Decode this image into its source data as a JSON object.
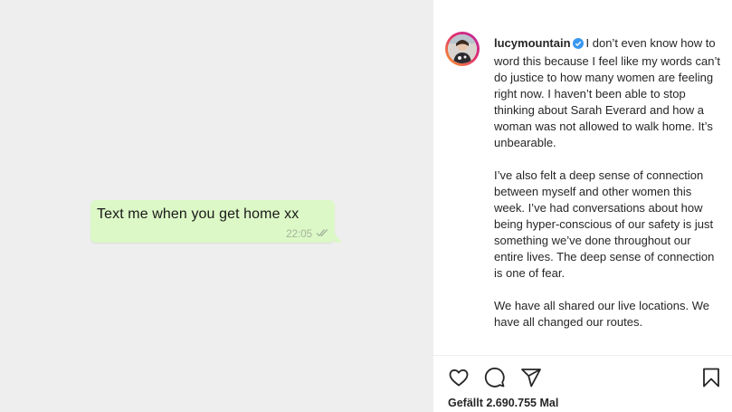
{
  "media": {
    "message_text": "Text me when you get home xx",
    "message_time": "22:05",
    "bubble_color": "#dcf8c6",
    "background_color": "#eeeeee"
  },
  "post": {
    "username": "lucymountain",
    "verified": true,
    "caption_first_line": "I don’t even know how to word this because I feel like my words can’t do justice to how many women are feeling right now. I haven’t been able to stop thinking about Sarah Everard and how a woman was not allowed to walk home. It’s unbearable.",
    "caption_p2": "I’ve also felt a deep sense of connection between myself and other women this week. I’ve had conversations about how being hyper-conscious of our safety is just something we’ve done throughout our entire lives. The deep sense of connection is one of fear.",
    "caption_p3": "We have all shared our live locations. We have all changed our routes."
  },
  "actions": {
    "icons": [
      "heart-icon",
      "comment-icon",
      "share-icon",
      "bookmark-icon"
    ],
    "likes_text": "Gefällt 2.690.755 Mal"
  }
}
